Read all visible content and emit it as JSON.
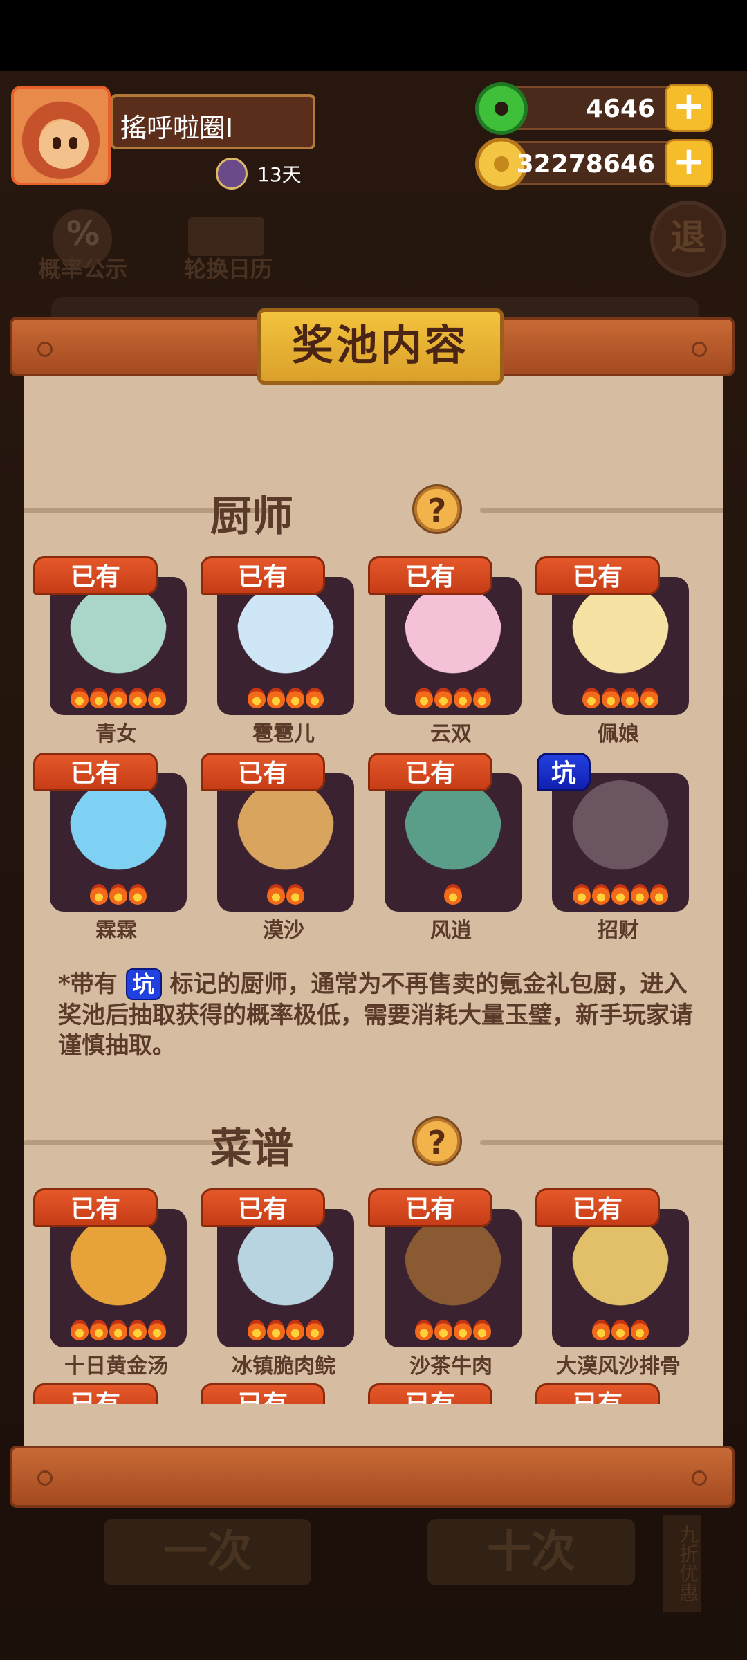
{
  "header": {
    "player_name": "搖呼啦圈I",
    "days": "13天",
    "jade_amount": "4646",
    "coin_amount": "32278646",
    "plus_label": "+"
  },
  "background": {
    "probability_label": "概率公示",
    "probability_icon_text": "%",
    "calendar_label": "轮换日历",
    "exit_label": "退",
    "btn_one": "一次",
    "btn_ten": "十次",
    "side_label": "九折优惠"
  },
  "panel": {
    "title": "奖池内容",
    "chefs_section": "厨师",
    "recipes_section": "菜谱",
    "help_icon": "?",
    "chefs": [
      {
        "name": "青女",
        "tag": "已有",
        "stars": 5,
        "color": "#a9d6c8"
      },
      {
        "name": "雹雹儿",
        "tag": "已有",
        "stars": 4,
        "color": "#cfe6f7"
      },
      {
        "name": "云双",
        "tag": "已有",
        "stars": 4,
        "color": "#f4c1d6"
      },
      {
        "name": "佩娘",
        "tag": "已有",
        "stars": 4,
        "color": "#f6e2a3"
      },
      {
        "name": "霖霖",
        "tag": "已有",
        "stars": 3,
        "color": "#7ed1f2"
      },
      {
        "name": "漠沙",
        "tag": "已有",
        "stars": 2,
        "color": "#d9a45e"
      },
      {
        "name": "风逍",
        "tag": "已有",
        "stars": 1,
        "color": "#5a9e8a"
      },
      {
        "name": "招财",
        "tag": "坑",
        "stars": 5,
        "color": "#6a5560"
      }
    ],
    "note_prefix": "*带有",
    "note_badge": "坑",
    "note_text": "标记的厨师，通常为不再售卖的氪金礼包厨，进入奖池后抽取获得的概率极低，需要消耗大量玉璧，新手玩家请谨慎抽取。",
    "recipes": [
      {
        "name": "十日黄金汤",
        "tag": "已有",
        "stars": 5,
        "color": "#e8a23a"
      },
      {
        "name": "冰镇脆肉鲩",
        "tag": "已有",
        "stars": 4,
        "color": "#b7d4e0"
      },
      {
        "name": "沙茶牛肉",
        "tag": "已有",
        "stars": 4,
        "color": "#8a5a32"
      },
      {
        "name": "大漠风沙排骨",
        "tag": "已有",
        "stars": 3,
        "color": "#e2c06a"
      }
    ],
    "recipes_next_tag": "已有"
  }
}
